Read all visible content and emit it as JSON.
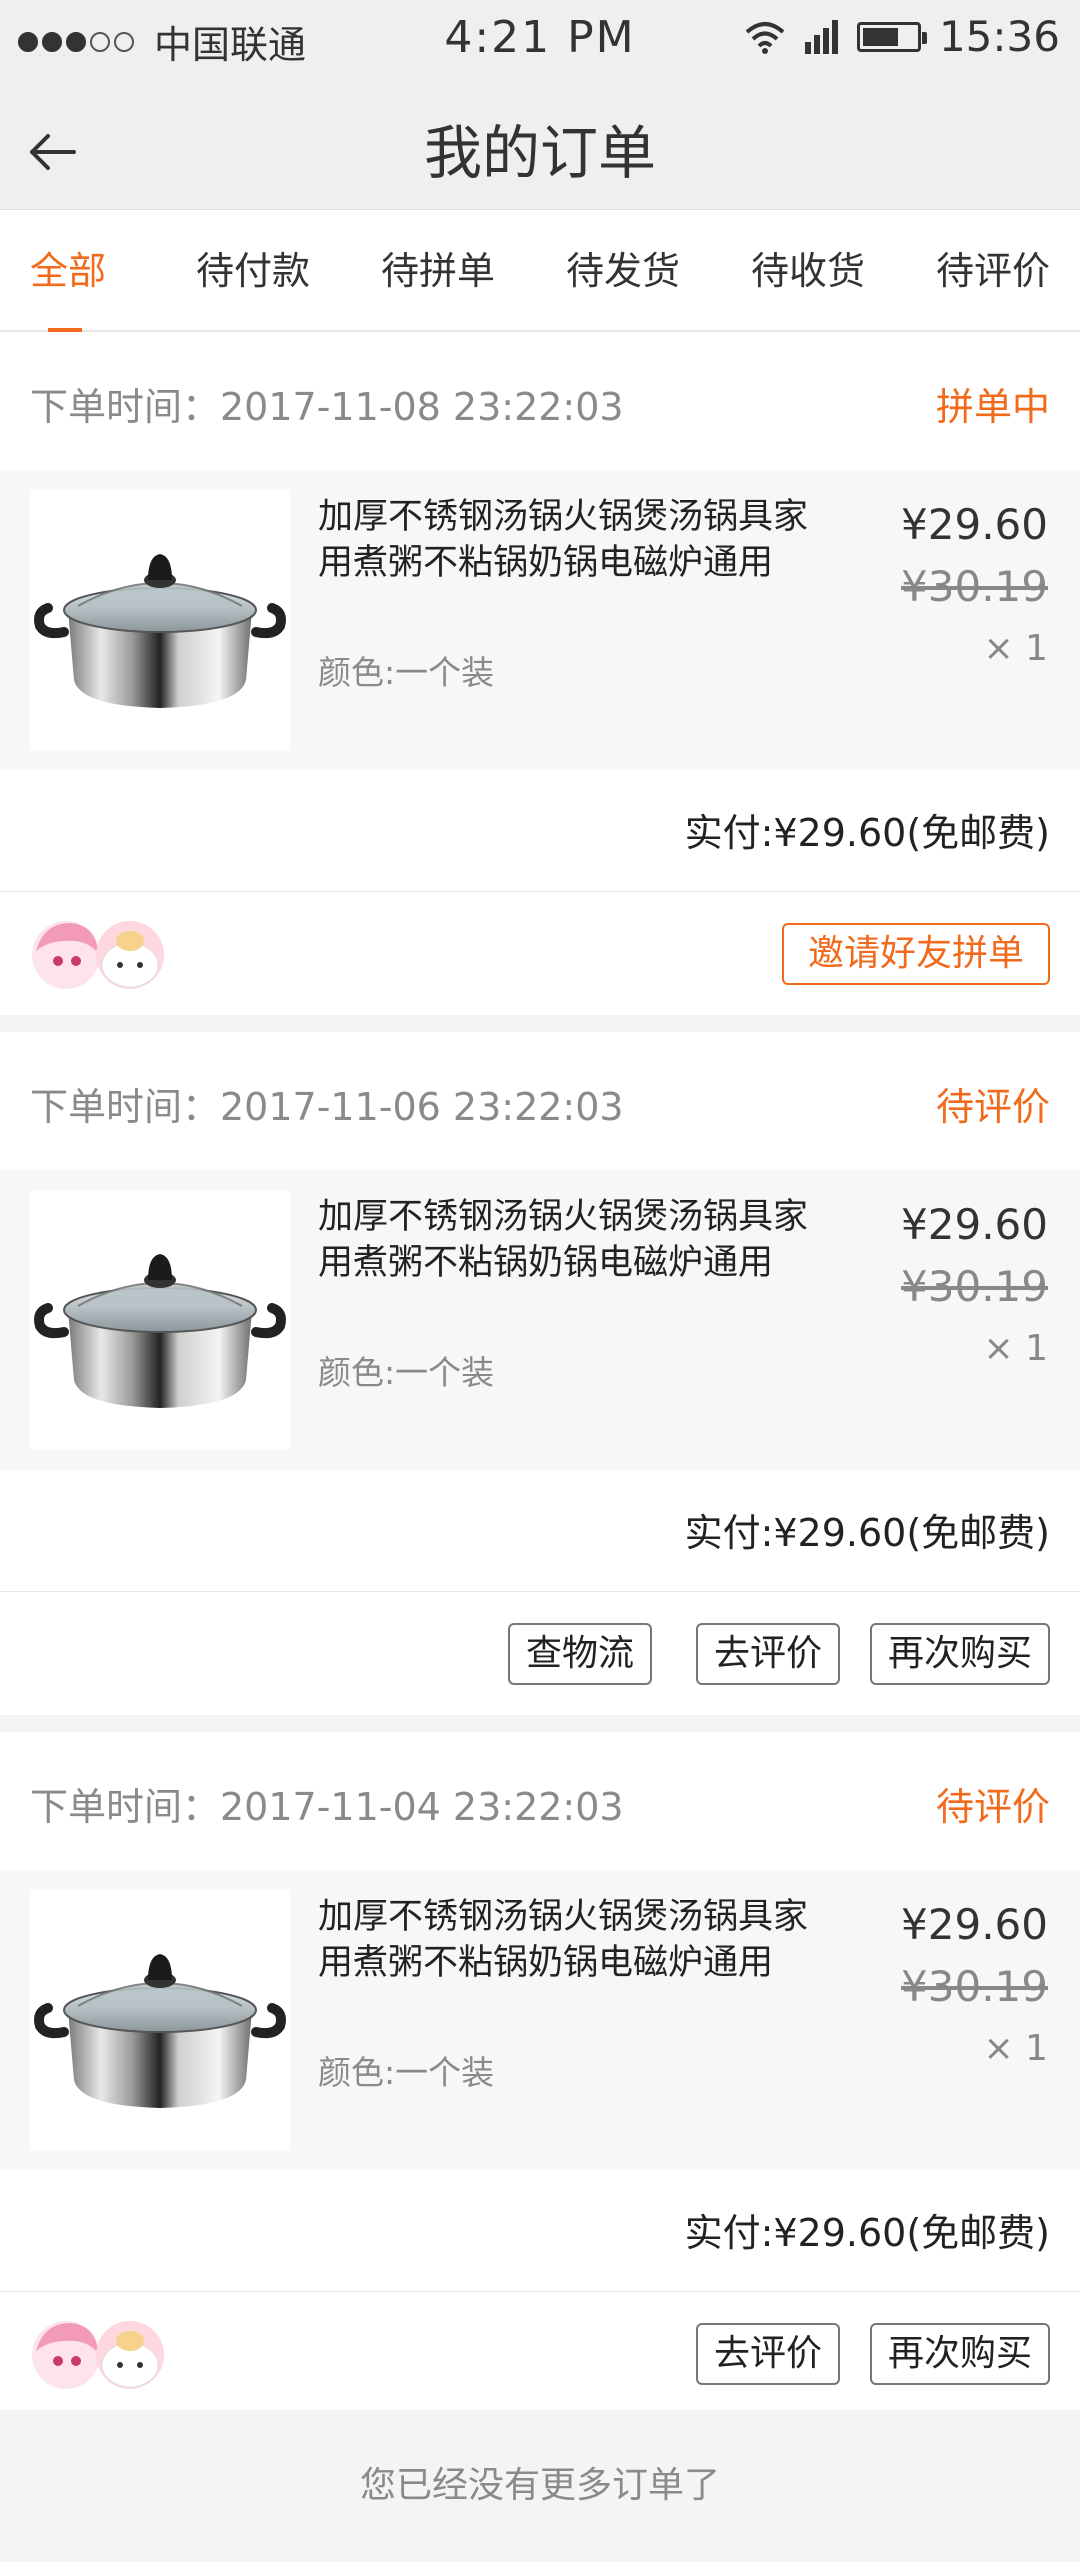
{
  "status_bar": {
    "carrier": "中国联通",
    "center_time": "4:21 PM",
    "right_time": "15:36",
    "battery_level": 0.7
  },
  "header": {
    "title": "我的订单"
  },
  "tabs": [
    {
      "label": "全部",
      "active": true
    },
    {
      "label": "待付款"
    },
    {
      "label": "待拼单"
    },
    {
      "label": "待发货"
    },
    {
      "label": "待收货"
    },
    {
      "label": "待评价"
    }
  ],
  "orders": [
    {
      "time": "下单时间：2017-11-08  23:22:03",
      "status": "拼单中",
      "product": {
        "title": "加厚不锈钢汤锅火锅煲汤锅具家用煮粥不粘锅奶锅电磁炉通用",
        "spec": "颜色:一个装",
        "price": "¥29.60",
        "orig_price": "¥30.19",
        "qty": "× 1"
      },
      "total": "实付:¥29.60(免邮费)",
      "buttons": [
        "邀请好友拼单"
      ]
    },
    {
      "time": "下单时间：2017-11-06  23:22:03",
      "status": "待评价",
      "product": {
        "title": "加厚不锈钢汤锅火锅煲汤锅具家用煮粥不粘锅奶锅电磁炉通用",
        "spec": "颜色:一个装",
        "price": "¥29.60",
        "orig_price": "¥30.19",
        "qty": "× 1"
      },
      "total": "实付:¥29.60(免邮费)",
      "buttons": [
        "查物流",
        "去评价",
        "再次购买"
      ]
    },
    {
      "time": "下单时间：2017-11-04  23:22:03",
      "status": "待评价",
      "product": {
        "title": "加厚不锈钢汤锅火锅煲汤锅具家用煮粥不粘锅奶锅电磁炉通用",
        "spec": "颜色:一个装",
        "price": "¥29.60",
        "orig_price": "¥30.19",
        "qty": "× 1"
      },
      "total": "实付:¥29.60(免邮费)",
      "buttons": [
        "去评价",
        "再次购买"
      ]
    }
  ],
  "footer": {
    "no_more": "您已经没有更多订单了"
  },
  "colors": {
    "accent": "#f26a1b",
    "bg": "#f4f4f4"
  }
}
